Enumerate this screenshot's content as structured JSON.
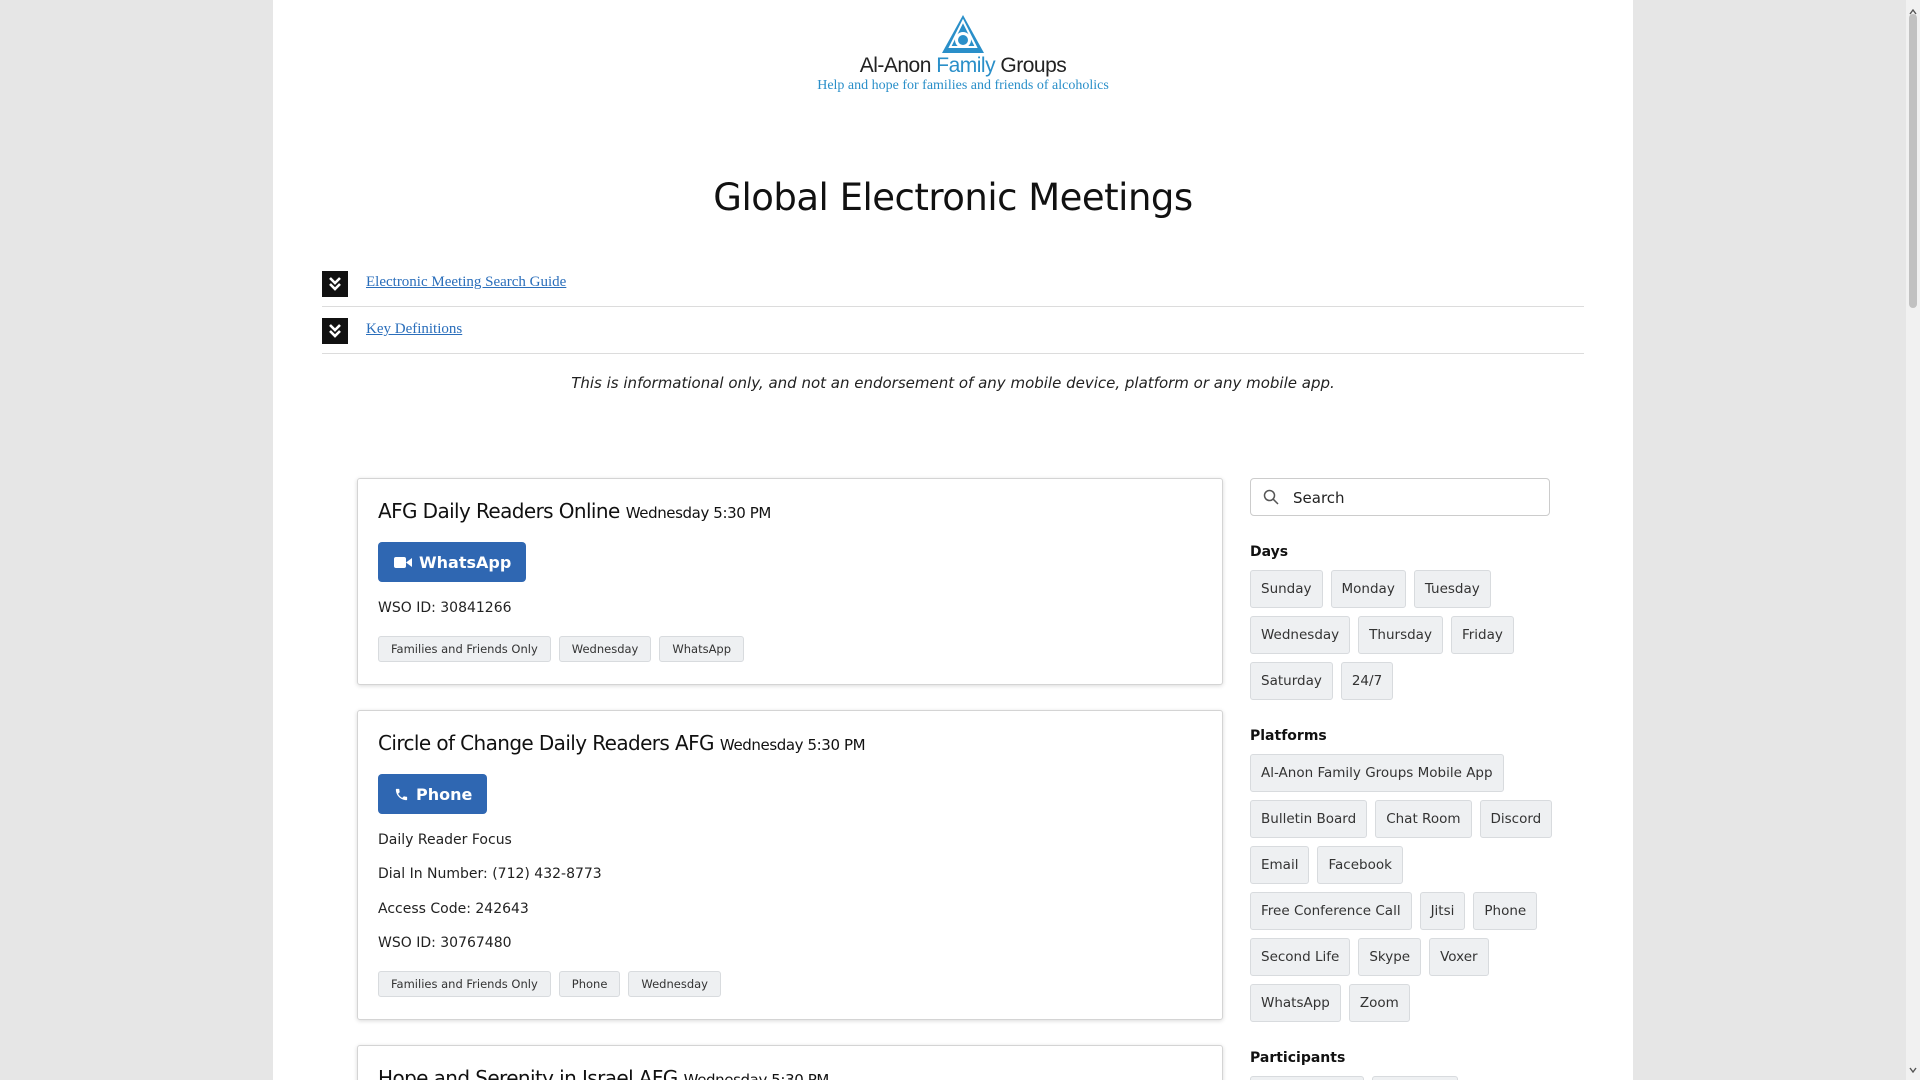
{
  "logo": {
    "brand_prefix": "Al-Anon ",
    "brand_family": "Family",
    "brand_suffix": " Groups",
    "tagline": "Help and hope for families and friends of alcoholics",
    "accent_color": "#2a8fc9"
  },
  "page_title": "Global Electronic Meetings",
  "accordion": [
    {
      "label": "Electronic Meeting Search Guide",
      "icon": "chevron-double-down-icon"
    },
    {
      "label": "Key Definitions",
      "icon": "chevron-double-down-icon"
    }
  ],
  "disclaimer": "This is informational only, and not an endorsement of any mobile device, platform or any mobile app.",
  "meetings": [
    {
      "name": "AFG Daily Readers Online",
      "time": "Wednesday 5:30 PM",
      "platform_button": "WhatsApp",
      "platform_icon": "video-camera-icon",
      "details": [
        "WSO ID: 30841266"
      ],
      "tags": [
        "Families and Friends Only",
        "Wednesday",
        "WhatsApp"
      ]
    },
    {
      "name": "Circle of Change Daily Readers AFG",
      "time": "Wednesday 5:30 PM",
      "platform_button": "Phone",
      "platform_icon": "phone-icon",
      "details": [
        "Daily Reader Focus",
        "Dial In Number: (712) 432-8773",
        "Access Code: 242643",
        "WSO ID: 30767480"
      ],
      "tags": [
        "Families and Friends Only",
        "Phone",
        "Wednesday"
      ]
    },
    {
      "name": "Hope and Serenity in Israel AFG",
      "time": "Wednesday 5:30 PM"
    }
  ],
  "search": {
    "placeholder": "Search",
    "icon": "search-icon"
  },
  "filters": {
    "days": {
      "label": "Days",
      "options": [
        "Sunday",
        "Monday",
        "Tuesday",
        "Wednesday",
        "Thursday",
        "Friday",
        "Saturday",
        "24/7"
      ]
    },
    "platforms": {
      "label": "Platforms",
      "options": [
        "Al-Anon Family Groups Mobile App",
        "Bulletin Board",
        "Chat Room",
        "Discord",
        "Email",
        "Facebook",
        "Free Conference Call",
        "Jitsi",
        "Phone",
        "Second Life",
        "Skype",
        "Voxer",
        "WhatsApp",
        "Zoom"
      ]
    },
    "participants": {
      "label": "Participants"
    }
  },
  "colors": {
    "primary_button": "#2f67b2",
    "link": "#2a6ebb",
    "tag_bg": "#eef0f2"
  }
}
